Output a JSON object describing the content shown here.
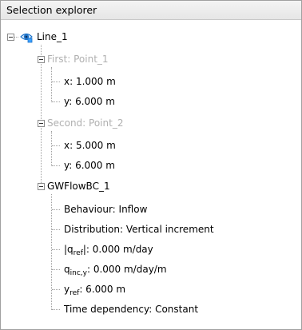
{
  "panel": {
    "title": "Selection explorer"
  },
  "tree": {
    "root": {
      "label": "Line_1",
      "icon": "visibility-eye-icon",
      "first": {
        "label": "First: Point_1",
        "x": "x: 1.000 m",
        "y": "y: 6.000 m"
      },
      "second": {
        "label": "Second: Point_2",
        "x": "x: 5.000 m",
        "y": "y: 6.000 m"
      },
      "bc": {
        "label": "GWFlowBC_1",
        "behaviour": "Behaviour: Inflow",
        "distribution": "Distribution: Vertical increment",
        "qref_prefix": "|q",
        "qref_sub": "ref",
        "qref_suffix": "|: 0.000 m/day",
        "qinc_prefix": "q",
        "qinc_sub": "inc,y",
        "qinc_suffix": ": 0.000 m/day/m",
        "yref_prefix": "y",
        "yref_sub": "ref",
        "yref_suffix": ": 6.000 m",
        "time": "Time dependency: Constant"
      }
    }
  },
  "colors": {
    "disabled_text": "#b0b0b0",
    "eye_blue": "#1f73c8"
  }
}
